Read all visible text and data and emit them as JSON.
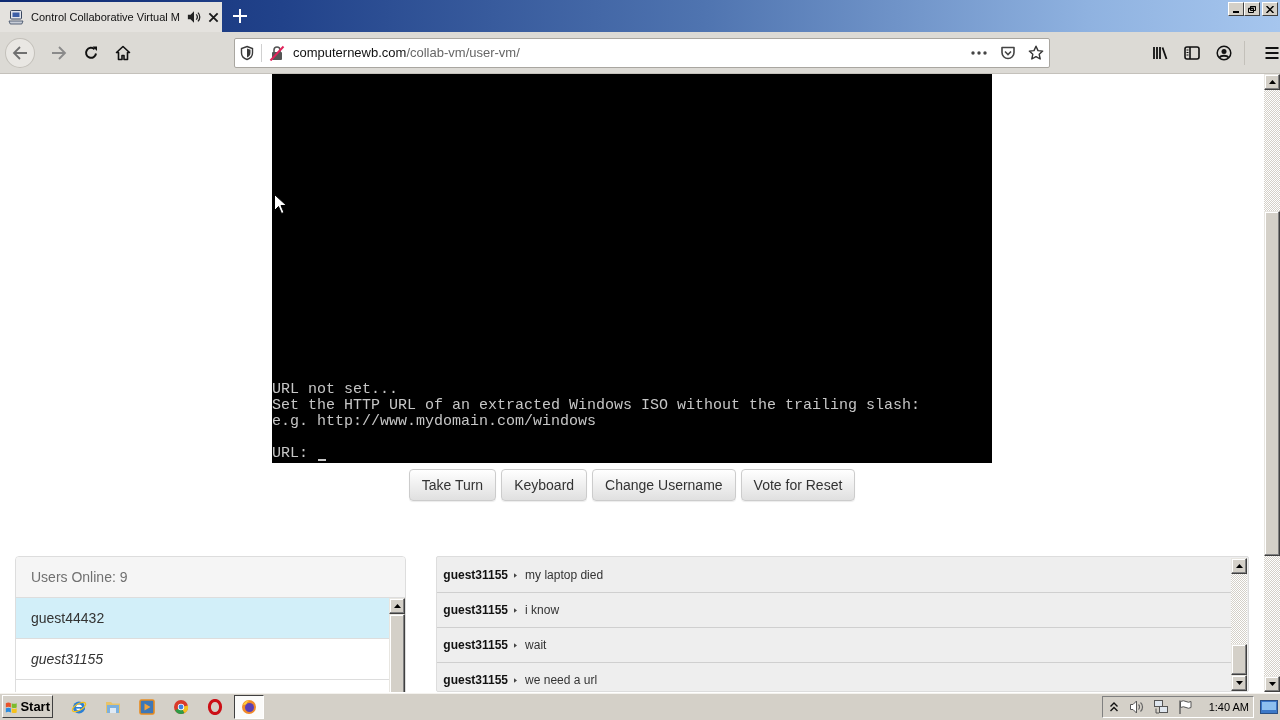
{
  "browser": {
    "tab": {
      "title": "Control Collaborative Virtual M",
      "selected": true
    },
    "address_bar": {
      "domain": "computernewb.com",
      "path": "/collab-vm/user-vm/"
    }
  },
  "vm_screen": {
    "lines": [
      "URL not set...",
      "Set the HTTP URL of an extracted Windows ISO without the trailing slash:",
      "e.g. http://www.mydomain.com/windows"
    ],
    "prompt": "URL:"
  },
  "controls": [
    "Take Turn",
    "Keyboard",
    "Change Username",
    "Vote for Reset"
  ],
  "users_panel": {
    "header": "Users Online: 9",
    "users": [
      {
        "name": "guest44432",
        "selected": true,
        "italic": false
      },
      {
        "name": "guest31155",
        "selected": false,
        "italic": true
      }
    ]
  },
  "chat": {
    "messages": [
      {
        "user": "guest31155",
        "text": "my laptop died"
      },
      {
        "user": "guest31155",
        "text": "i know"
      },
      {
        "user": "guest31155",
        "text": "wait"
      },
      {
        "user": "guest31155",
        "text": "we need a url"
      }
    ]
  },
  "taskbar": {
    "start": "Start",
    "apps": [
      {
        "kind": "e-logo",
        "selected": false
      },
      {
        "kind": "folder",
        "selected": false
      },
      {
        "kind": "play",
        "selected": false
      },
      {
        "kind": "circle-logo",
        "selected": false
      },
      {
        "kind": "ring-logo",
        "selected": false
      },
      {
        "kind": "fox-globe",
        "selected": true
      }
    ],
    "clock": "1:40 AM"
  }
}
